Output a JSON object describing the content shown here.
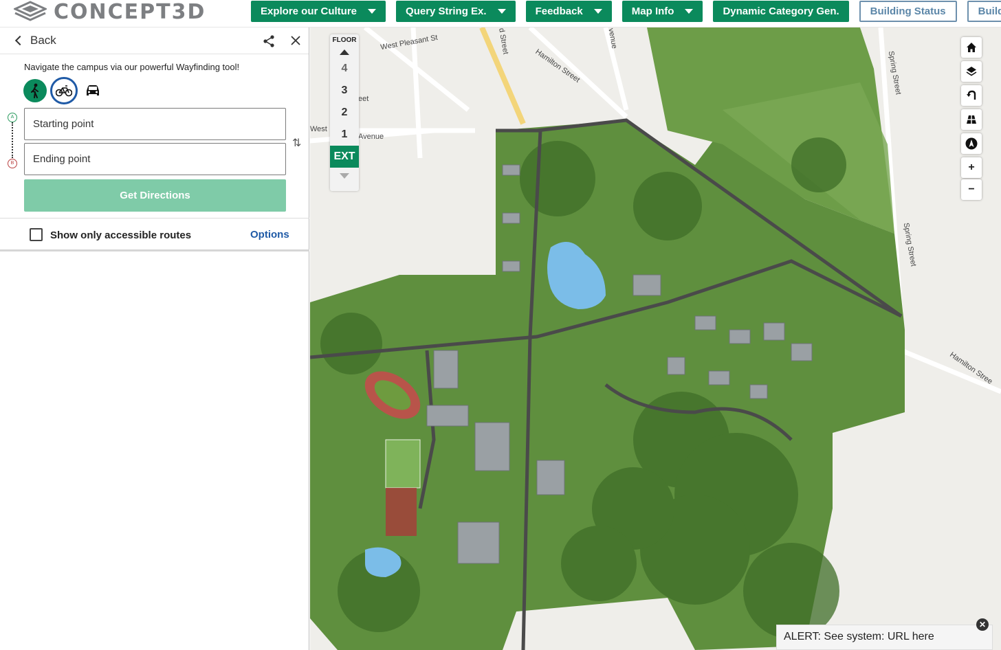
{
  "header": {
    "logo_text": "CONCEPT3D",
    "nav": [
      {
        "label": "Explore our Culture",
        "dropdown": true
      },
      {
        "label": "Query String Ex.",
        "dropdown": true
      },
      {
        "label": "Feedback",
        "dropdown": true
      },
      {
        "label": "Map Info",
        "dropdown": true
      },
      {
        "label": "Dynamic Category Gen.",
        "dropdown": false
      },
      {
        "label": "Building Status",
        "outline": true
      },
      {
        "label": "Building C",
        "outline": true
      }
    ]
  },
  "panel": {
    "back_label": "Back",
    "intro": "Navigate the campus via our powerful Wayfinding tool!",
    "modes": [
      "walk-icon",
      "bike-icon",
      "car-icon"
    ],
    "start_placeholder": "Starting point",
    "end_placeholder": "Ending point",
    "pin_a": "A",
    "pin_b": "B",
    "get_directions": "Get Directions",
    "accessible_label": "Show only accessible routes",
    "options_label": "Options"
  },
  "map": {
    "floor": {
      "title": "FLOOR",
      "levels": [
        "4",
        "3",
        "2",
        "1",
        "EXT"
      ],
      "active": "EXT"
    },
    "controls": {
      "zoom_in": "+",
      "zoom_out": "−"
    },
    "streets": [
      "West Pleasant St",
      "Hamilton Street",
      "Avenue",
      "West",
      "Spring Street",
      "Spring Street",
      "Hamilton Stree",
      "venue",
      "d Street",
      "eet"
    ],
    "alert": "ALERT: See system: URL here",
    "alert_close": "✕"
  },
  "colors": {
    "brand_green": "#0b8a5c",
    "link_blue": "#1f5aa6",
    "button_disabled": "#7fcba8"
  }
}
